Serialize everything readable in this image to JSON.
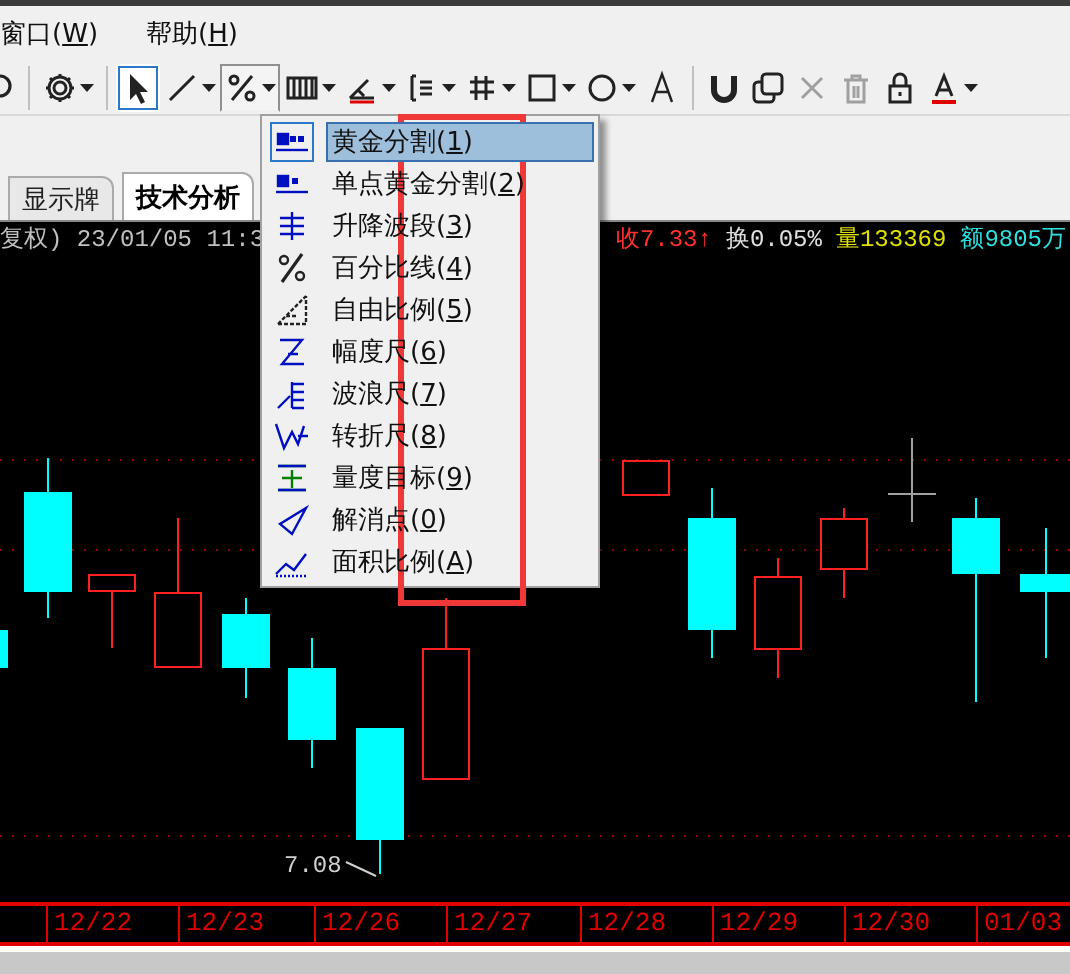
{
  "menubar": [
    {
      "label": "窗口(W)"
    },
    {
      "label": "帮助(H)"
    }
  ],
  "toolbar": [
    {
      "selected": false,
      "pressed": false,
      "disabled": false,
      "dropdown": true
    },
    {
      "selected": true,
      "pressed": false,
      "disabled": false,
      "dropdown": false
    },
    {
      "selected": false,
      "pressed": false,
      "disabled": false,
      "dropdown": true
    },
    {
      "selected": false,
      "pressed": true,
      "disabled": false,
      "dropdown": true
    },
    {
      "selected": false,
      "pressed": false,
      "disabled": false,
      "dropdown": true
    },
    {
      "selected": false,
      "pressed": false,
      "disabled": false,
      "dropdown": true
    },
    {
      "selected": false,
      "pressed": false,
      "disabled": false,
      "dropdown": true
    },
    {
      "selected": false,
      "pressed": false,
      "disabled": false,
      "dropdown": true
    },
    {
      "selected": false,
      "pressed": false,
      "disabled": false,
      "dropdown": true
    },
    {
      "selected": false,
      "pressed": false,
      "disabled": false,
      "dropdown": true
    },
    {
      "selected": false,
      "pressed": false,
      "disabled": false,
      "dropdown": false
    },
    {
      "selected": false,
      "pressed": false,
      "disabled": false,
      "dropdown": false
    },
    {
      "selected": false,
      "pressed": false,
      "disabled": false,
      "dropdown": false
    },
    {
      "selected": false,
      "pressed": false,
      "disabled": true,
      "dropdown": false
    },
    {
      "selected": false,
      "pressed": false,
      "disabled": true,
      "dropdown": false
    },
    {
      "selected": false,
      "pressed": false,
      "disabled": false,
      "dropdown": false
    },
    {
      "selected": false,
      "pressed": false,
      "disabled": false,
      "dropdown": true
    }
  ],
  "tabs": [
    {
      "label": "显示牌",
      "selected": false
    },
    {
      "label": "技术分析",
      "selected": true
    }
  ],
  "quote": [
    {
      "kind": "time",
      "text": "复权) 23/01/05 11:3"
    },
    {
      "kind": "close",
      "text": "收7.33↑"
    },
    {
      "kind": "turnover",
      "text": "换0.05%"
    },
    {
      "kind": "volume",
      "text": "量133369"
    },
    {
      "kind": "amount",
      "text": "额9805万"
    }
  ],
  "chart": {
    "low_label": "7.08",
    "dates": [
      "12/22",
      "12/23",
      "12/26",
      "12/27",
      "12/28",
      "12/29",
      "12/30",
      "01/03"
    ]
  },
  "dropdown_menu": [
    {
      "label": "黄金分割(1)",
      "selected": true
    },
    {
      "label": "单点黄金分割(2)",
      "selected": false
    },
    {
      "label": "升降波段(3)",
      "selected": false
    },
    {
      "label": "百分比线(4)",
      "selected": false
    },
    {
      "label": "自由比例(5)",
      "selected": false
    },
    {
      "label": "幅度尺(6)",
      "selected": false
    },
    {
      "label": "波浪尺(7)",
      "selected": false
    },
    {
      "label": "转折尺(8)",
      "selected": false
    },
    {
      "label": "量度目标(9)",
      "selected": false
    },
    {
      "label": "解消点(0)",
      "selected": false
    },
    {
      "label": "面积比例(A)",
      "selected": false
    }
  ]
}
